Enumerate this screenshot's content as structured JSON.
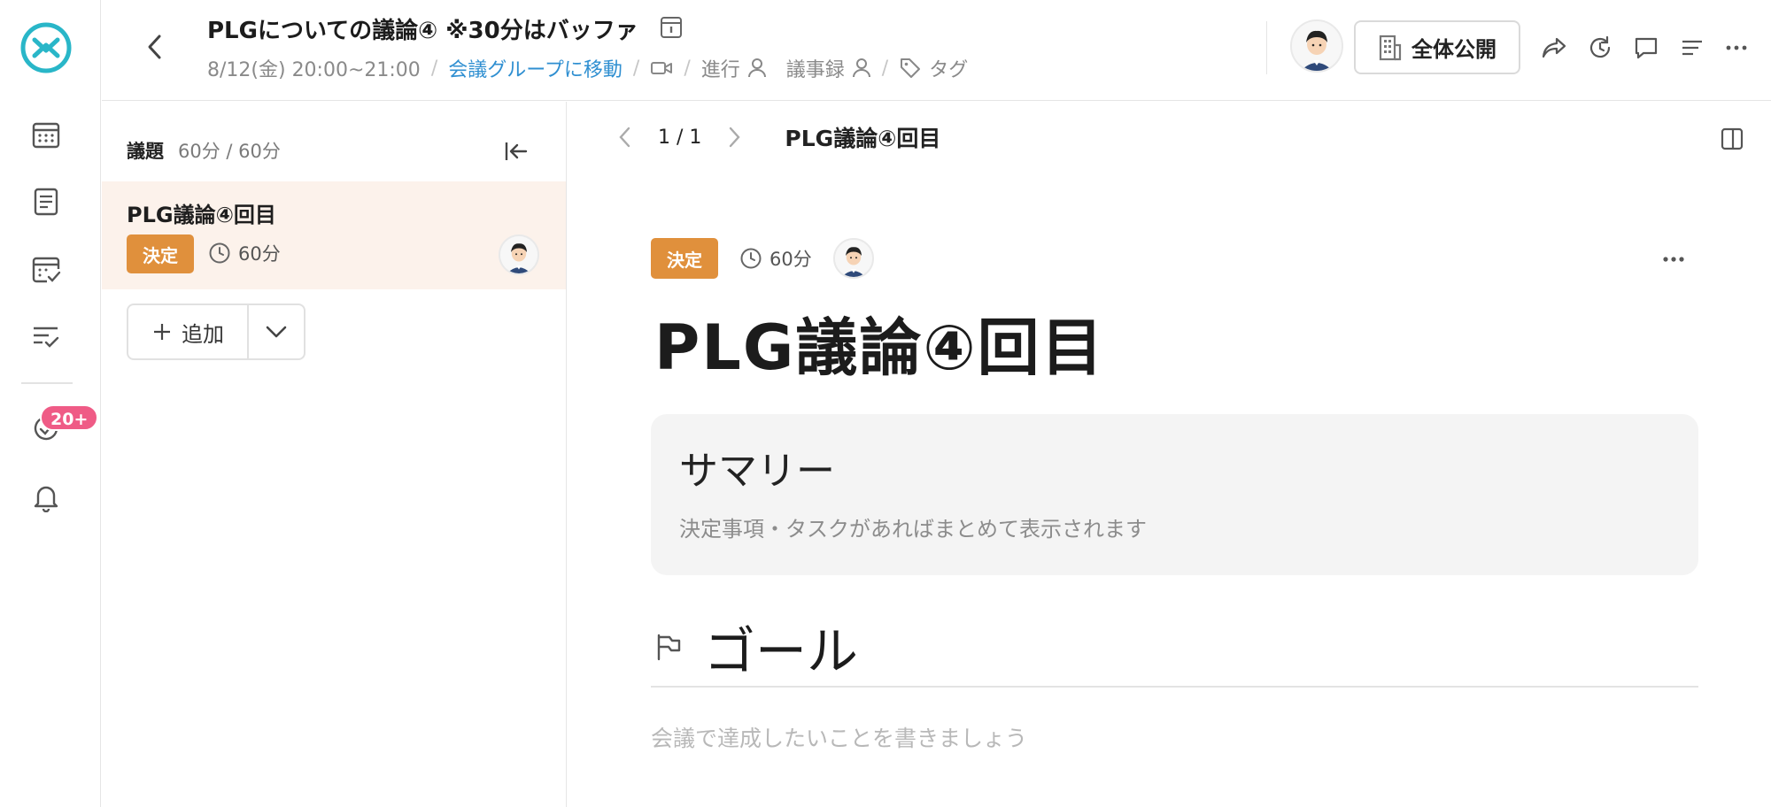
{
  "sidebar": {
    "badge": "20+",
    "items": [
      {
        "icon": "logo-icon"
      },
      {
        "icon": "calendar-icon"
      },
      {
        "icon": "document-icon"
      },
      {
        "icon": "calendar-check-icon"
      },
      {
        "icon": "task-list-icon"
      },
      {
        "icon": "activity-icon"
      },
      {
        "icon": "bell-icon"
      }
    ]
  },
  "header": {
    "title": "PLGについての議論④ ※30分はバッファ",
    "datetime": "8/12(金) 20:00~21:00",
    "move_group_link": "会議グループに移動",
    "facilitator_label": "進行",
    "minutes_label": "議事録",
    "tag_label": "タグ",
    "separator": "/",
    "publish_label": "全体公開"
  },
  "agenda": {
    "label": "議題",
    "count": "60分 / 60分",
    "items": [
      {
        "title": "PLG議論④回目",
        "status": "決定",
        "duration": "60分"
      }
    ],
    "add_label": "追加"
  },
  "main": {
    "page_current": "1",
    "page_separator": "/",
    "page_total": "1",
    "page_title": "PLG議論④回目",
    "status": "決定",
    "duration": "60分",
    "topic_title": "PLG議論④回目",
    "summary": {
      "heading": "サマリー",
      "placeholder": "決定事項・タスクがあればまとめて表示されます"
    },
    "goal": {
      "heading": "ゴール",
      "placeholder": "会議で達成したいことを書きましょう"
    }
  },
  "colors": {
    "brand": "#29b6c8",
    "accent_link": "#2f8fd1",
    "tag_decided": "#e0903c",
    "badge": "#ef5b86",
    "selected_row": "#fcf2eb"
  }
}
